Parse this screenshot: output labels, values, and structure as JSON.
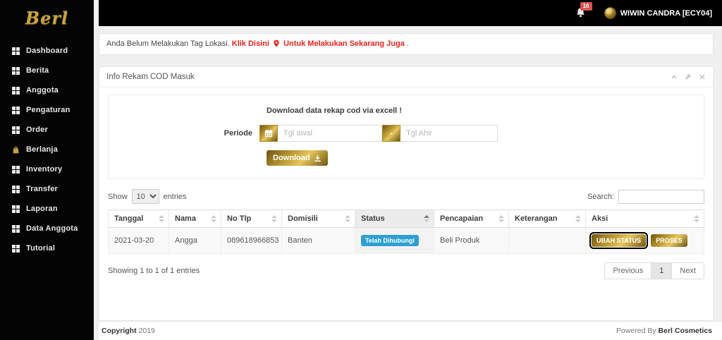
{
  "topbar": {
    "notification_count": "16",
    "user_name": "WIWIN CANDRA [ECY04]"
  },
  "sidebar": {
    "logo": "Berl",
    "items": [
      {
        "label": "Dashboard",
        "icon": "grid-icon"
      },
      {
        "label": "Berita",
        "icon": "grid-icon"
      },
      {
        "label": "Anggota",
        "icon": "grid-icon"
      },
      {
        "label": "Pengaturan",
        "icon": "grid-icon"
      },
      {
        "label": "Order",
        "icon": "grid-icon"
      },
      {
        "label": "Berlanja",
        "icon": "shopping-bag-icon"
      },
      {
        "label": "Inventory",
        "icon": "grid-icon"
      },
      {
        "label": "Transfer",
        "icon": "grid-icon"
      },
      {
        "label": "Laporan",
        "icon": "grid-icon"
      },
      {
        "label": "Data Anggota",
        "icon": "grid-icon"
      },
      {
        "label": "Tutorial",
        "icon": "grid-icon"
      }
    ]
  },
  "alert": {
    "prefix": "Anda Belum Melakukan Tag Lokasi.",
    "link1": "Klik Disini",
    "link2": "Untuk Melakukan Sekarang Juga",
    "suffix": "."
  },
  "panel": {
    "title": "Info Rekam COD Masuk",
    "download_heading": "Download data rekap cod via excell !",
    "periode_label": "Periode",
    "tgl_awal_placeholder": "Tgl awal",
    "separator": "-",
    "tgl_ahir_placeholder": "Tgl Ahir",
    "download_button": "Download"
  },
  "table_controls": {
    "show_label": "Show",
    "page_length": "10",
    "entries_label": "entries",
    "search_label": "Search:"
  },
  "table": {
    "headers": [
      "Tanggal",
      "Nama",
      "No Tlp",
      "Domisili",
      "Status",
      "Pencapaian",
      "Keterangan",
      "Aksi"
    ],
    "row": {
      "tanggal": "2021-03-20",
      "nama": "Angga",
      "no_tlp": "089618966853",
      "domisili": "Banten",
      "status_badge": "Telah Dihubungi",
      "pencapaian": "Beli Produk",
      "keterangan": "",
      "aksi": [
        "UBAH STATUS",
        "PROSES"
      ]
    },
    "info": "Showing 1 to 1 of 1 entries"
  },
  "pagination": {
    "previous": "Previous",
    "page": "1",
    "next": "Next"
  },
  "footer": {
    "left_bold": "Copyright",
    "left_rest": "2019",
    "right_prefix": "Powered By",
    "right_bold": "Berl Cosmetics"
  },
  "colors": {
    "gold_accent": "#c3a037",
    "status_badge_blue": "#2e9fd4",
    "alert_link_red": "#e8241d",
    "notification_badge_red": "#d9534f"
  }
}
